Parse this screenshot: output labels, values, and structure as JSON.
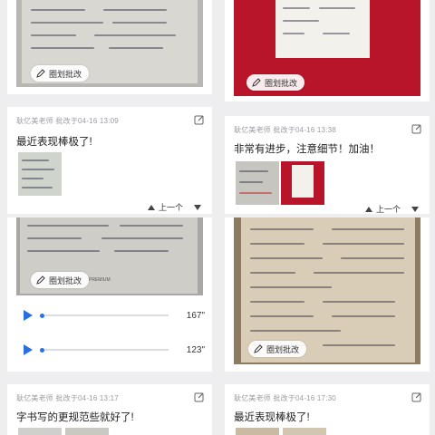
{
  "cards": {
    "left_top": {
      "badge": "圈划批改"
    },
    "left_comment1": {
      "meta": "耿亿美老师 批改于04-16 13:09",
      "comment": "最近表现棒极了!",
      "pager": {
        "prev": "上一个"
      }
    },
    "left_media": {
      "badge": "圈划批改",
      "watermark": "PREMIUM",
      "audio": [
        {
          "duration": "167\""
        },
        {
          "duration": "123\""
        }
      ]
    },
    "left_comment2": {
      "meta": "耿亿美老师 批改于04-16 13:17",
      "comment": "字书写的更规范些就好了!"
    },
    "right_top": {
      "badge": "圈划批改"
    },
    "right_comment1": {
      "meta": "耿亿美老师 批改于04-16 13:38",
      "comment": "非常有进步，注意细节！加油！",
      "pager": {
        "prev": "上一个"
      }
    },
    "right_media": {
      "badge": "圈划批改"
    },
    "right_comment2": {
      "meta": "耿亿美老师 批改于04-16 17:30",
      "comment": "最近表现棒极了!"
    }
  },
  "colors": {
    "accent": "#2a6fe0",
    "red_board": "#b8142a",
    "paper": "#e8e7e2"
  },
  "icons": {
    "badge": "pencil-icon",
    "edit": "edit-icon",
    "audio": "play-icon"
  }
}
